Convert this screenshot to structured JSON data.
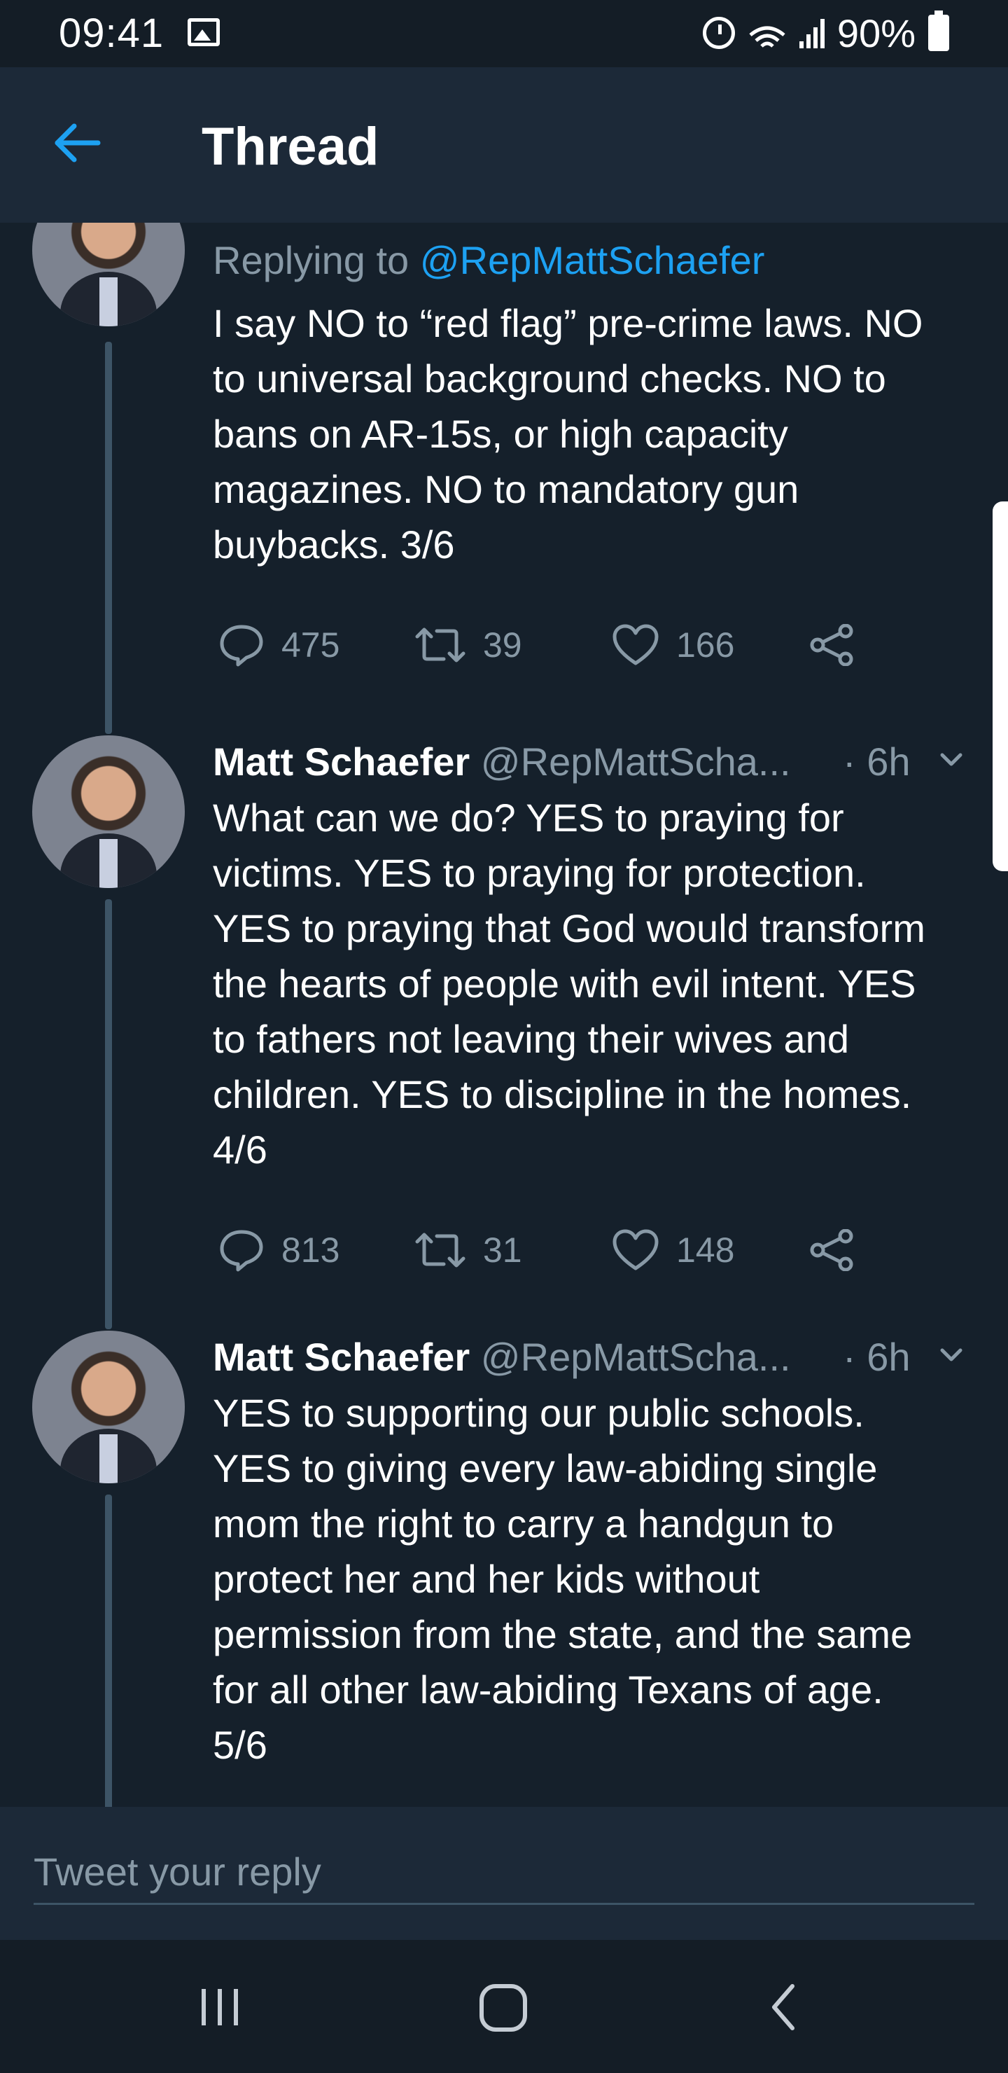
{
  "status": {
    "time": "09:41",
    "battery": "90%"
  },
  "header": {
    "title": "Thread"
  },
  "tweets": [
    {
      "reply_prefix": "Replying to ",
      "reply_handle": "@RepMattSchaefer",
      "text": "I say NO to “red flag” pre-crime laws. NO\nto universal background checks. NO to\nbans on AR-15s, or high capacity\nmagazines. NO to mandatory gun\nbuybacks.  3/6",
      "replies": "475",
      "retweets": "39",
      "likes": "166"
    },
    {
      "name": "Matt Schaefer",
      "handle": "@RepMattScha...",
      "time": "· 6h",
      "text": "What can we do? YES to praying for\nvictims. YES to praying for protection.\nYES to praying that God would transform\nthe hearts of people with evil intent. YES\nto fathers not leaving their wives and\nchildren. YES to discipline in the homes.\n4/6",
      "replies": "813",
      "retweets": "31",
      "likes": "148"
    },
    {
      "name": "Matt Schaefer",
      "handle": "@RepMattScha...",
      "time": "· 6h",
      "text": "YES to supporting our public schools.\nYES to giving every law-abiding single\nmom the right to carry a handgun to\nprotect her and her kids without\npermission from the state, and the same\nfor all other law-abiding Texans of age.\n5/6"
    }
  ],
  "reply_bar": {
    "placeholder": "Tweet your reply"
  },
  "colors": {
    "background": "#15202b",
    "accent": "#1da1f2",
    "secondary_text": "#8899a6"
  }
}
